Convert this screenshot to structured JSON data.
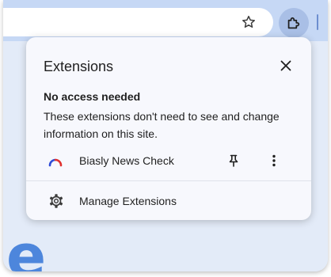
{
  "toolbar": {
    "bookmark_icon": "star-outline-icon",
    "extensions_icon": "puzzle-piece-icon"
  },
  "popup": {
    "title": "Extensions",
    "close_icon": "close-icon",
    "section_heading": "No access needed",
    "section_description": "These extensions don't need to see and change information on this site.",
    "extensions": [
      {
        "name": "Biasly News Check",
        "icon": "rainbow-arc-icon",
        "pin_icon": "pin-icon",
        "menu_icon": "more-vert-icon"
      }
    ],
    "manage_label": "Manage Extensions",
    "manage_icon": "gear-icon"
  },
  "page": {
    "letter": "e"
  },
  "colors": {
    "toolbar_bg": "#c6d8f5",
    "page_bg": "#e3ebf8",
    "popup_bg": "#f7f8fd",
    "extension_button_bg": "#a9bfe6",
    "page_letter": "#4d86dc",
    "text": "#1f1f1f"
  }
}
